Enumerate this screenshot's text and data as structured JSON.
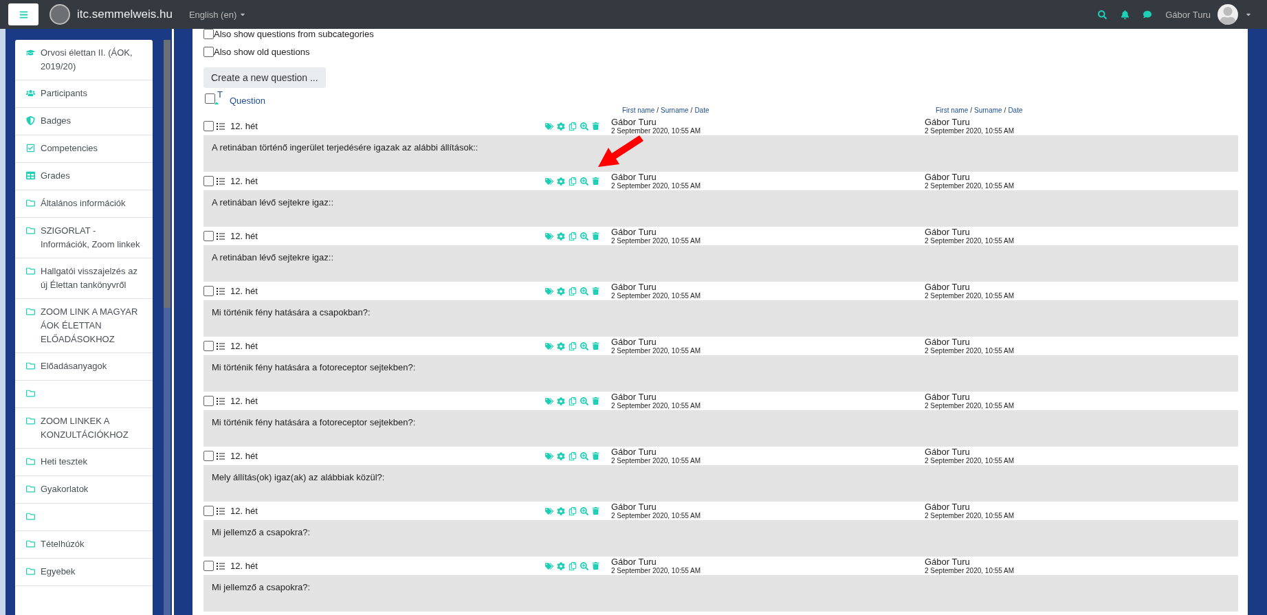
{
  "navbar": {
    "site_name": "itc.semmelweis.hu",
    "language": "English (en)",
    "user_name": "Gábor Turu"
  },
  "sidebar": {
    "items": [
      {
        "kind": "course",
        "label": "Orvosi élettan II. (ÁOK, 2019/20)"
      },
      {
        "kind": "participants",
        "label": "Participants"
      },
      {
        "kind": "badges",
        "label": "Badges"
      },
      {
        "kind": "competencies",
        "label": "Competencies"
      },
      {
        "kind": "grades",
        "label": "Grades"
      },
      {
        "kind": "folder",
        "label": "Általános információk"
      },
      {
        "kind": "folder",
        "label": "SZIGORLAT - Információk, Zoom linkek"
      },
      {
        "kind": "folder",
        "label": "Hallgatói visszajelzés az új Élettan tankönyvről"
      },
      {
        "kind": "folder",
        "label": "ZOOM LINK A MAGYAR ÁOK ÉLETTAN ELŐADÁSOKHOZ"
      },
      {
        "kind": "folder",
        "label": "Előadásanyagok"
      },
      {
        "kind": "folder"
      },
      {
        "kind": "folder",
        "label": "ZOOM LINKEK A KONZULTÁCIÓKHOZ"
      },
      {
        "kind": "folder",
        "label": "Heti tesztek"
      },
      {
        "kind": "folder",
        "label": "Gyakorlatok"
      },
      {
        "kind": "folder"
      },
      {
        "kind": "folder",
        "label": "Tételhúzók"
      },
      {
        "kind": "folder",
        "label": "Egyebek"
      }
    ]
  },
  "filters": [
    {
      "label": "Also show questions from subcategories",
      "checked": false
    },
    {
      "label": "Also show old questions",
      "checked": false
    }
  ],
  "create_button": "Create a new question ...",
  "table": {
    "select_all_checked": false,
    "type_header": "T",
    "question_header": "Question",
    "created_by_header": [
      {
        "kind": "link",
        "text": "First name"
      },
      {
        "kind": "separator",
        "text": "/"
      },
      {
        "kind": "link",
        "text": "Surname"
      },
      {
        "kind": "separator",
        "text": "/"
      },
      {
        "kind": "link",
        "text": "Date"
      }
    ],
    "modified_by_header": [
      {
        "kind": "link",
        "text": "First name"
      },
      {
        "kind": "separator",
        "text": "/"
      },
      {
        "kind": "link",
        "text": "Surname"
      },
      {
        "kind": "separator",
        "text": "/"
      },
      {
        "kind": "link",
        "text": "Date"
      }
    ],
    "rows": [
      {
        "checked": false,
        "name": "12. hét",
        "text": "A retinában történő ingerület terjedésére igazak az alábbi állítások::",
        "created_by": "Gábor Turu",
        "created": "2 September 2020, 10:55 AM",
        "modified_by": "Gábor Turu",
        "modified": "2 September 2020, 10:55 AM"
      },
      {
        "checked": false,
        "name": "12. hét",
        "text": "A retinában lévő sejtekre igaz::",
        "created_by": "Gábor Turu",
        "created": "2 September 2020, 10:55 AM",
        "modified_by": "Gábor Turu",
        "modified": "2 September 2020, 10:55 AM"
      },
      {
        "checked": false,
        "name": "12. hét",
        "text": "A retinában lévő sejtekre igaz::",
        "created_by": "Gábor Turu",
        "created": "2 September 2020, 10:55 AM",
        "modified_by": "Gábor Turu",
        "modified": "2 September 2020, 10:55 AM"
      },
      {
        "checked": false,
        "name": "12. hét",
        "text": "Mi történik fény hatására a csapokban?:",
        "created_by": "Gábor Turu",
        "created": "2 September 2020, 10:55 AM",
        "modified_by": "Gábor Turu",
        "modified": "2 September 2020, 10:55 AM"
      },
      {
        "checked": false,
        "name": "12. hét",
        "text": "Mi történik fény hatására a fotoreceptor sejtekben?:",
        "created_by": "Gábor Turu",
        "created": "2 September 2020, 10:55 AM",
        "modified_by": "Gábor Turu",
        "modified": "2 September 2020, 10:55 AM"
      },
      {
        "checked": false,
        "name": "12. hét",
        "text": "Mi történik fény hatására a fotoreceptor sejtekben?:",
        "created_by": "Gábor Turu",
        "created": "2 September 2020, 10:55 AM",
        "modified_by": "Gábor Turu",
        "modified": "2 September 2020, 10:55 AM"
      },
      {
        "checked": false,
        "name": "12. hét",
        "text": "Mely állítás(ok) igaz(ak) az alábbiak közül?:",
        "created_by": "Gábor Turu",
        "created": "2 September 2020, 10:55 AM",
        "modified_by": "Gábor Turu",
        "modified": "2 September 2020, 10:55 AM"
      },
      {
        "checked": false,
        "name": "12. hét",
        "text": "Mi jellemző a csapokra?:",
        "created_by": "Gábor Turu",
        "created": "2 September 2020, 10:55 AM",
        "modified_by": "Gábor Turu",
        "modified": "2 September 2020, 10:55 AM"
      },
      {
        "checked": false,
        "name": "12. hét",
        "text": "Mi jellemző a csapokra?:",
        "created_by": "Gábor Turu",
        "created": "2 September 2020, 10:55 AM",
        "modified_by": "Gábor Turu",
        "modified": "2 September 2020, 10:55 AM"
      }
    ]
  }
}
